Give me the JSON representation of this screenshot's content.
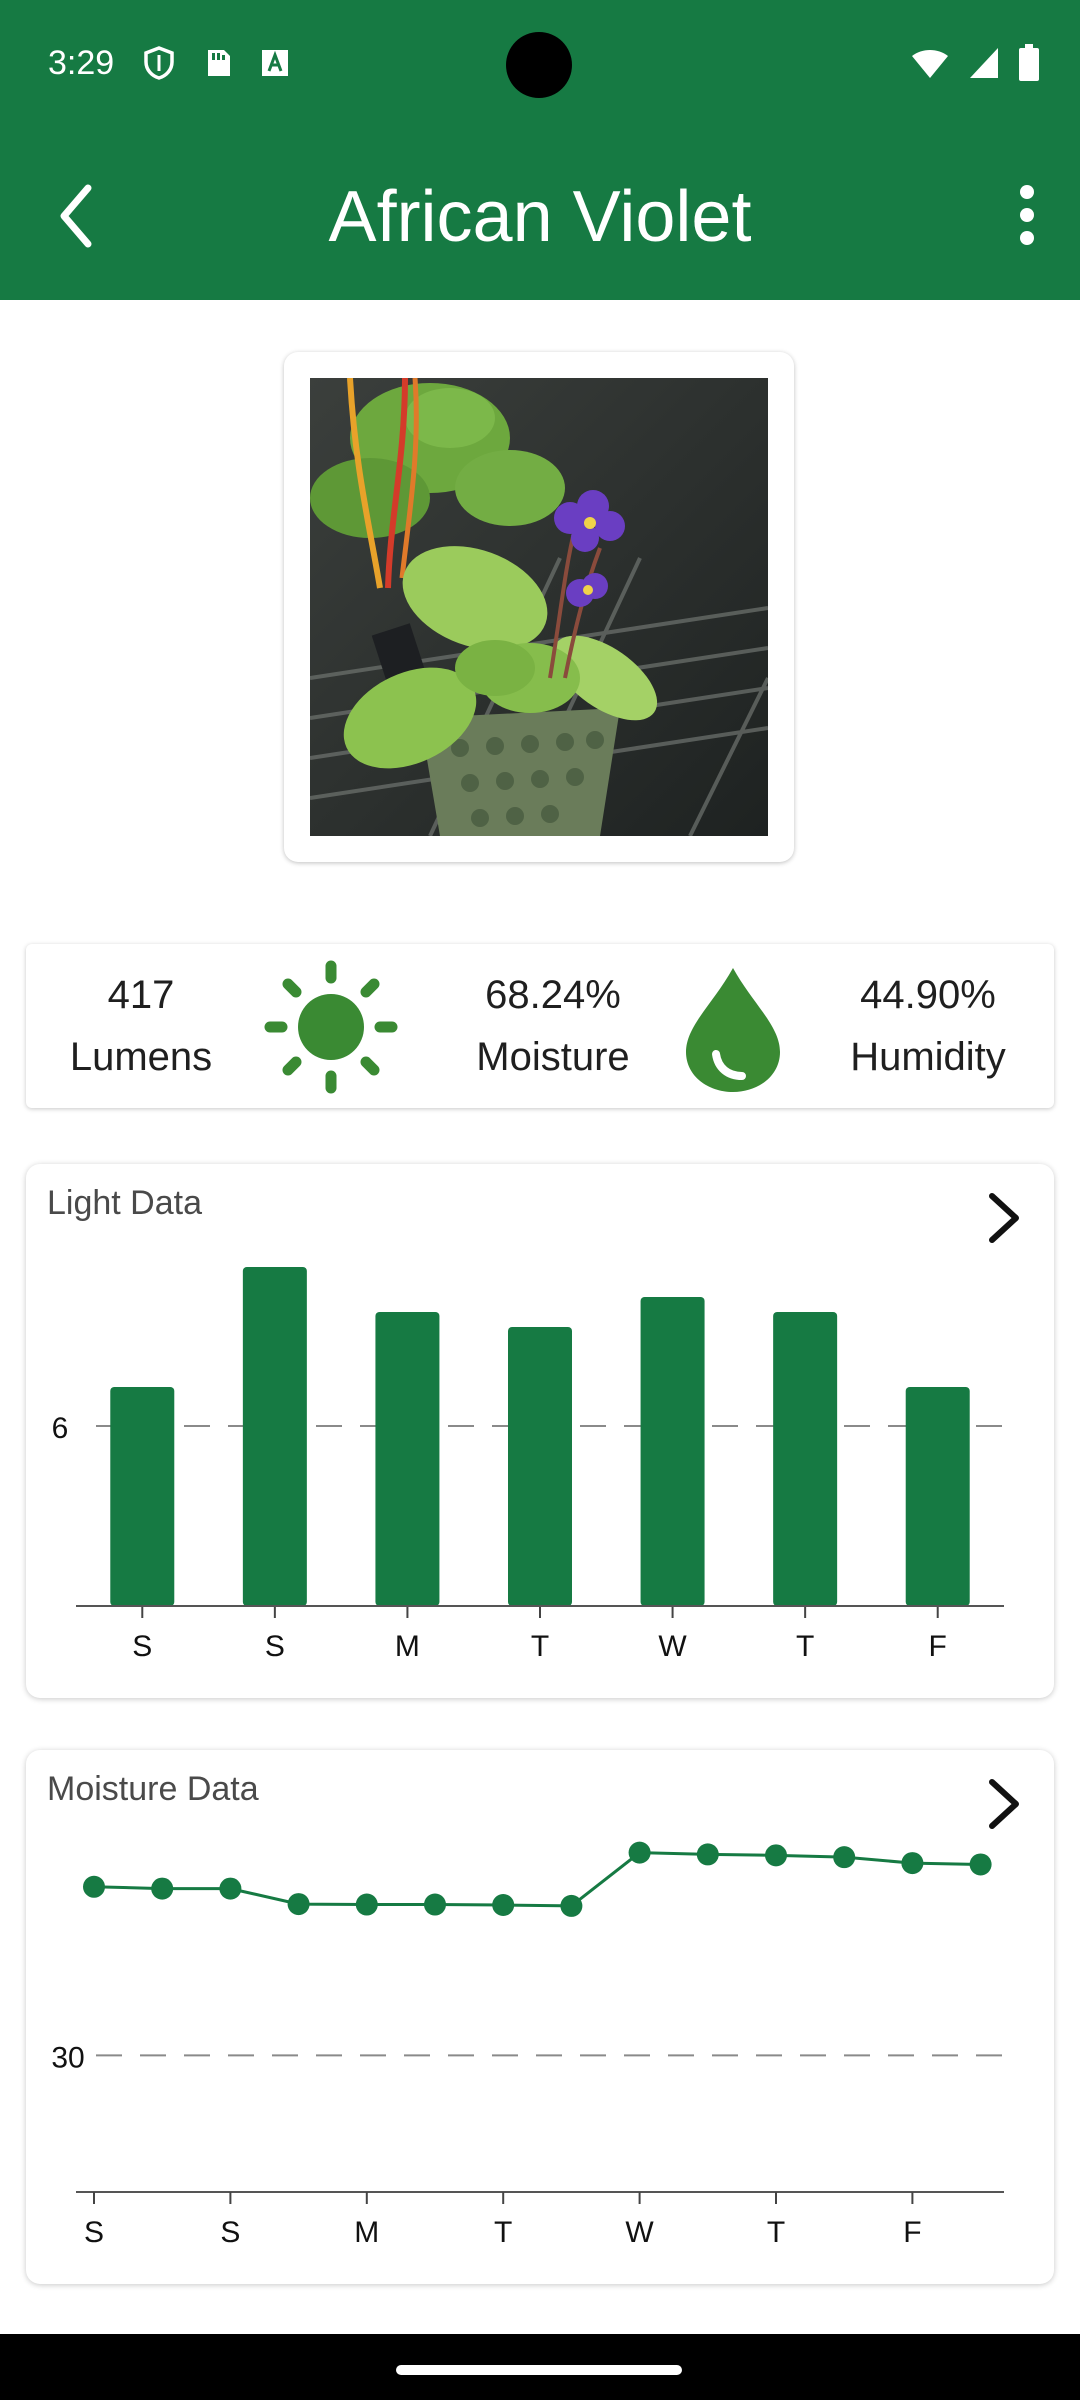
{
  "status_bar": {
    "time": "3:29",
    "left_icons": [
      "shield-icon",
      "sd-card-icon",
      "text-a-icon"
    ],
    "right_icons": [
      "wifi-icon",
      "signal-icon",
      "battery-icon"
    ]
  },
  "app_bar": {
    "title": "African Violet",
    "back_icon": "back-arrow-icon",
    "menu_icon": "more-vert-icon",
    "color": "#167a43"
  },
  "plant_photo": {
    "label": "plant-photo"
  },
  "stats": {
    "light": {
      "value": "417",
      "label": "Lumens",
      "icon": "sun-icon"
    },
    "moisture": {
      "value": "68.24%",
      "label": "Moisture",
      "icon": "sun-icon"
    },
    "humidity": {
      "value": "44.90%",
      "label": "Humidity",
      "icon": "water-drop-icon"
    },
    "icon_color": "#3a8a33"
  },
  "chart_data": [
    {
      "type": "bar",
      "title": "Light Data",
      "categories": [
        "S",
        "S",
        "M",
        "T",
        "W",
        "T",
        "F"
      ],
      "values": [
        7.3,
        11.3,
        9.8,
        9.3,
        10.3,
        9.8,
        7.3
      ],
      "reference_line": {
        "value": 6,
        "label": "6"
      },
      "ylim": [
        0,
        12
      ],
      "color": "#167a43"
    },
    {
      "type": "line",
      "title": "Moisture Data",
      "x_ticks": [
        "S",
        "S",
        "M",
        "T",
        "W",
        "T",
        "F"
      ],
      "values": [
        67.0,
        66.6,
        66.6,
        63.2,
        63.1,
        63.1,
        63.0,
        62.8,
        74.5,
        74.1,
        73.9,
        73.5,
        72.2,
        71.9
      ],
      "reference_line": {
        "value": 30,
        "label": "30"
      },
      "ylim": [
        0,
        90
      ],
      "color": "#167a43"
    }
  ]
}
